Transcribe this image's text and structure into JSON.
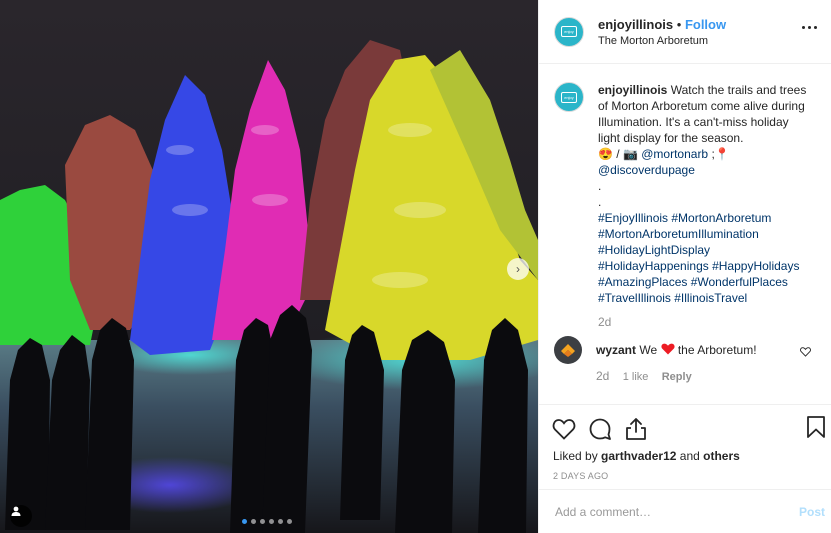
{
  "header": {
    "username": "enjoyillinois",
    "separator": "•",
    "follow_label": "Follow",
    "location": "The Morton Arboretum",
    "avatar_text": "enjoy illinois"
  },
  "caption": {
    "username": "enjoyillinois",
    "text": "Watch the trails and trees of Morton Arboretum come alive during Illumination. It's a can't-miss holiday light display for the season.",
    "emoji_line_prefix": "😍 / 📷",
    "mention1": "@mortonarb",
    "mention1_suffix": ";📍",
    "mention2": "@discoverdupage",
    "dots": ".\n.",
    "hashtags": "#EnjoyIllinois #MortonArboretum\n#MortonArboretumIllumination\n#HolidayLightDisplay\n#HolidayHappenings #HappyHolidays\n#AmazingPlaces #WonderfulPlaces\n#TravelIllinois #IllinoisTravel",
    "age": "2d"
  },
  "comment": {
    "username": "wyzant",
    "text_before": "We",
    "text_after": "the Arboretum!",
    "age": "2d",
    "likes": "1 like",
    "reply_label": "Reply"
  },
  "likes": {
    "prefix": "Liked by",
    "user": "garthvader12",
    "middle": "and",
    "others": "others"
  },
  "timestamp": "2 DAYS AGO",
  "add_comment": {
    "placeholder": "Add a comment…",
    "post_label": "Post"
  },
  "carousel": {
    "total": 6,
    "active_index": 0,
    "next_arrow": "›"
  },
  "colors": {
    "link": "#3897f0",
    "hashtag": "#003569",
    "heart": "#ed4956",
    "avatar": "#2bb5c9"
  },
  "icons": [
    "heart-icon",
    "comment-icon",
    "share-icon",
    "bookmark-icon",
    "more-icon",
    "user-tag-icon"
  ]
}
